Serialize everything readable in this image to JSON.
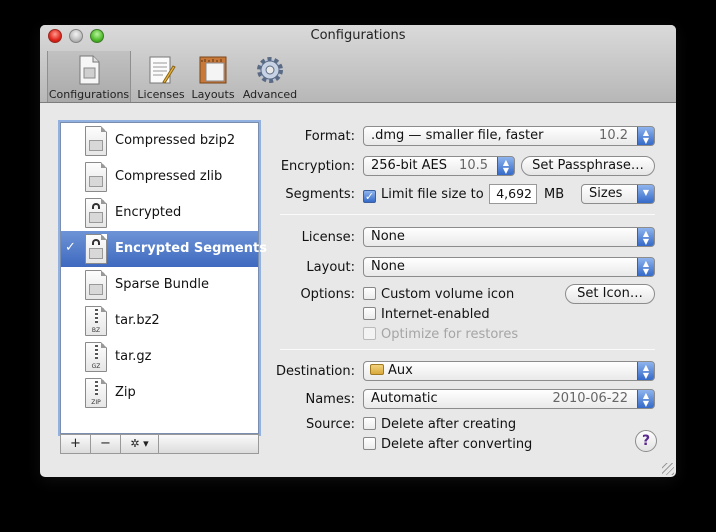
{
  "window": {
    "title": "Configurations"
  },
  "toolbar": {
    "items": [
      {
        "label": "Configurations",
        "icon": "document-icon"
      },
      {
        "label": "Licenses",
        "icon": "license-icon"
      },
      {
        "label": "Layouts",
        "icon": "layout-icon"
      },
      {
        "label": "Advanced",
        "icon": "gear-icon"
      }
    ],
    "selected": "Configurations"
  },
  "list": {
    "items": [
      {
        "name": "Compressed bzip2",
        "tag": ""
      },
      {
        "name": "Compressed zlib",
        "tag": ""
      },
      {
        "name": "Encrypted",
        "tag": ""
      },
      {
        "name": "Encrypted Segments",
        "tag": ""
      },
      {
        "name": "Sparse Bundle",
        "tag": ""
      },
      {
        "name": "tar.bz2",
        "tag": "BZ"
      },
      {
        "name": "tar.gz",
        "tag": "GZ"
      },
      {
        "name": "Zip",
        "tag": "ZIP"
      }
    ],
    "selected_index": 3,
    "checkmark": "✓",
    "add_label": "+",
    "remove_label": "−",
    "action_label": "✲ ▾"
  },
  "form": {
    "format_label": "Format:",
    "format_value": ".dmg — smaller file, faster",
    "format_hint": "10.2",
    "encryption_label": "Encryption:",
    "encryption_value": "256-bit AES",
    "encryption_hint": "10.5",
    "set_passphrase": "Set Passphrase…",
    "segments_label": "Segments:",
    "limit_label": "Limit file size to",
    "limit_checked": true,
    "limit_value": "4,692",
    "limit_unit": "MB",
    "sizes_value": "Sizes",
    "license_label": "License:",
    "license_value": "None",
    "layout_label": "Layout:",
    "layout_value": "None",
    "options_label": "Options:",
    "custom_icon": "Custom volume icon",
    "set_icon": "Set Icon…",
    "internet_enabled": "Internet-enabled",
    "optimize": "Optimize for restores",
    "destination_label": "Destination:",
    "destination_value": "Aux",
    "names_label": "Names:",
    "names_value": "Automatic",
    "names_hint": "2010-06-22",
    "source_label": "Source:",
    "delete_creating": "Delete after creating",
    "delete_converting": "Delete after converting",
    "help": "?"
  },
  "colors": {
    "accent": "#3e69bf",
    "window": "#e8e8e8"
  }
}
